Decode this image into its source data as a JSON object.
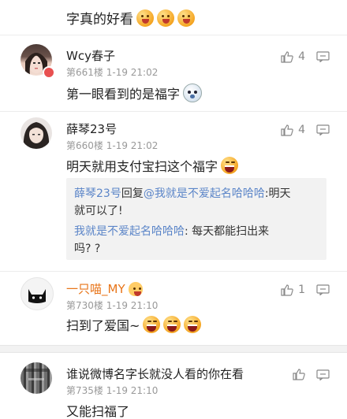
{
  "top": {
    "text": "字真的好看",
    "emoji_count": 3
  },
  "comments": [
    {
      "name": "Wcy春子",
      "floor": "第661楼",
      "time": "1-19 21:02",
      "likes": "4",
      "text": "第一眼看到的是福字"
    },
    {
      "name": "薛琴23号",
      "floor": "第660楼",
      "time": "1-19 21:02",
      "likes": "4",
      "text": "明天就用支付宝扫这个福字",
      "replies": {
        "r1_name": "薛琴23号",
        "r1_word": "回复",
        "r1_target": "@我就是不爱起名哈哈哈",
        "r1_text_a": ":明天",
        "r1_text_b": "就可以了!",
        "r2_name": "我就是不爱起名哈哈哈",
        "r2_text_a": ": 每天都能扫出来",
        "r2_text_b": "吗? ?"
      }
    },
    {
      "name": "一只喵_MY",
      "floor": "第730楼",
      "time": "1-19 21:10",
      "likes": "1",
      "text": "扫到了爱国~"
    },
    {
      "name": "谁说微博名字长就没人看的你在看",
      "floor": "第735楼",
      "time": "1-19 21:10",
      "text": "又能扫福了"
    }
  ],
  "colors": {
    "link_blue": "#5b85c8",
    "orange_name": "#e8751a",
    "badge_red": "#e85050"
  }
}
